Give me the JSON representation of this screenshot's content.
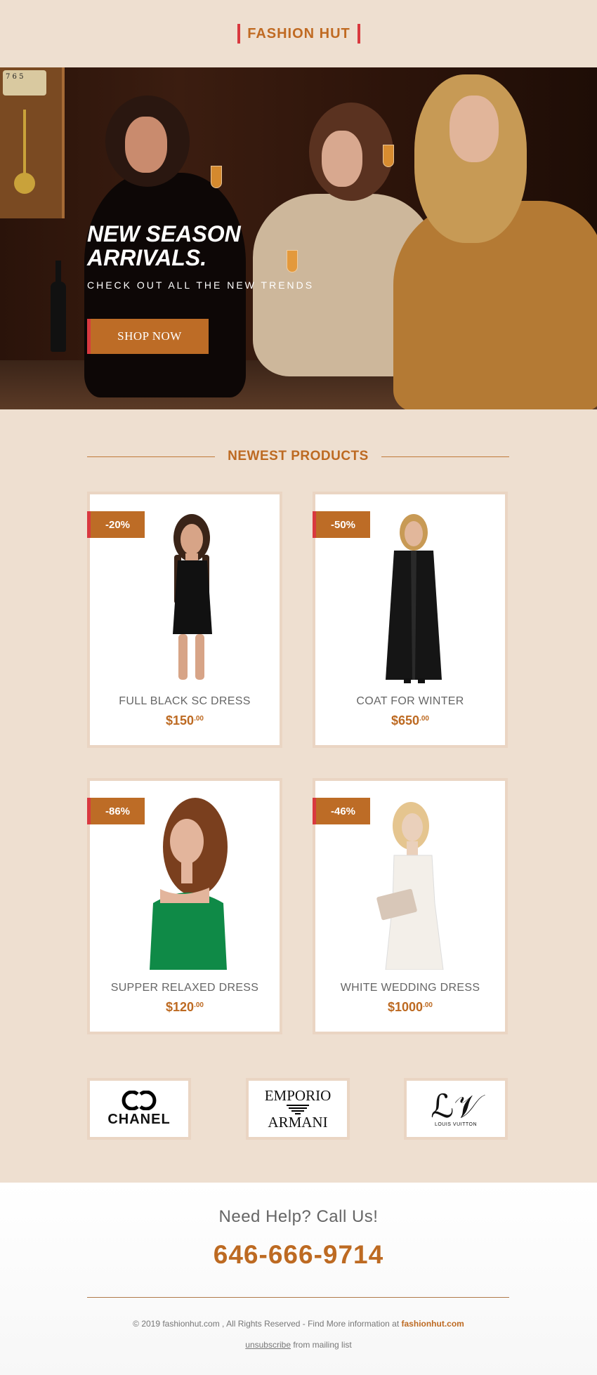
{
  "header": {
    "brand": "FASHION HUT"
  },
  "hero": {
    "title_line1": "NEW SEASON",
    "title_line2": "ARRIVALS.",
    "subtitle": "CHECK OUT ALL THE NEW TRENDS",
    "cta_label": "SHOP NOW",
    "clock_numbers": "7 6 5"
  },
  "section": {
    "title": "NEWEST PRODUCTS"
  },
  "products": [
    {
      "badge": "-20%",
      "name": "FULL BLACK SC DRESS",
      "price": "$150",
      "cents": ".00"
    },
    {
      "badge": "-50%",
      "name": "COAT FOR WINTER",
      "price": "$650",
      "cents": ".00"
    },
    {
      "badge": "-86%",
      "name": "SUPPER RELAXED DRESS",
      "price": "$120",
      "cents": ".00"
    },
    {
      "badge": "-46%",
      "name": "WHITE WEDDING DRESS",
      "price": "$1000",
      "cents": ".00"
    }
  ],
  "brands": [
    {
      "name": "CHANEL"
    },
    {
      "line1": "EMPORIO",
      "line2": "ARMANI"
    },
    {
      "name": "LOUIS VUITTON"
    }
  ],
  "footer": {
    "help": "Need Help? Call Us!",
    "phone": "646-666-9714",
    "copyright": "© 2019 fashionhut.com , All Rights Reserved  -  Find More information at",
    "site": "fashionhut.com",
    "unsubscribe": "unsubscribe",
    "unsubscribe_suffix": "from mailing list"
  },
  "colors": {
    "background": "#eedfd0",
    "accent": "#bd6a22",
    "accent_red": "#d9393f"
  }
}
